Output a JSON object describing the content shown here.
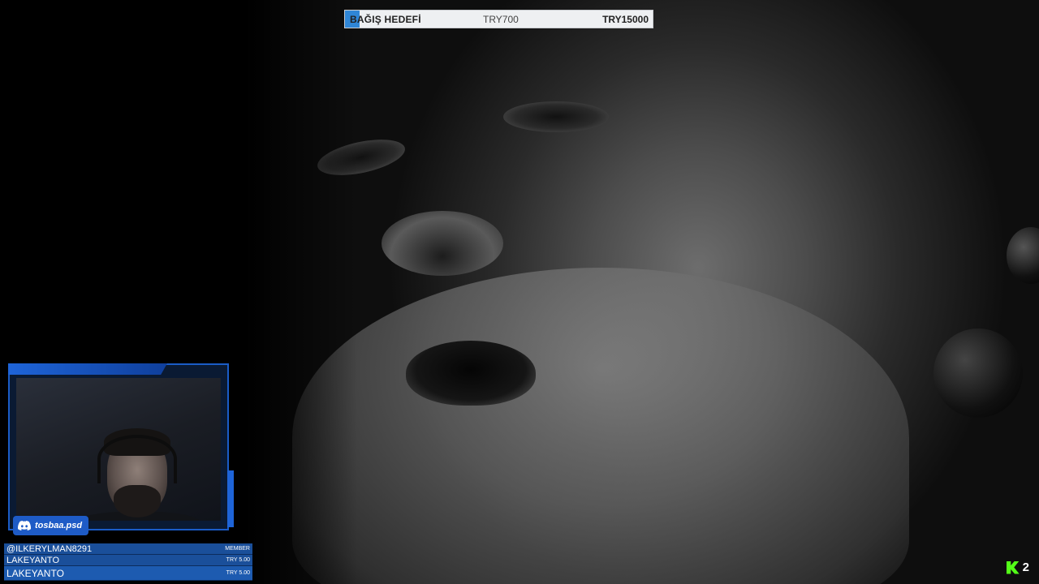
{
  "donation_goal": {
    "label": "BAĞIŞ HEDEFİ",
    "current": "TRY700",
    "target": "TRY15000",
    "progress_fraction": 0.047,
    "fill_color": "#2f86d6"
  },
  "discord_badge": {
    "icon": "discord-icon",
    "handle": "tosbaa.psd"
  },
  "events": [
    {
      "name": "@ILKERYLMAN8291",
      "detail": "MEMBER"
    },
    {
      "name": "LAKEYANTO",
      "detail": "TRY 5.00"
    },
    {
      "name": "LAKEYANTO",
      "detail": "TRY 5.00"
    }
  ],
  "brand": {
    "icon": "kick-logo-icon",
    "number": "2",
    "color": "#53fc18"
  },
  "accent_color": "#1e5bc6"
}
